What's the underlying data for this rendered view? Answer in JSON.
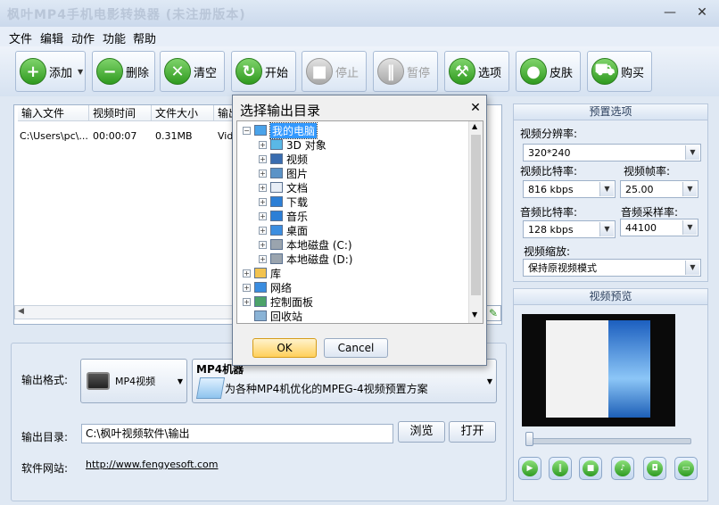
{
  "window": {
    "title": "枫叶MP4手机电影转换器  (未注册版本)",
    "minimize": "—",
    "close": "✕"
  },
  "menu": [
    "文件",
    "编辑",
    "动作",
    "功能",
    "帮助"
  ],
  "toolbar": {
    "add": "添加",
    "delete": "删除",
    "clear": "清空",
    "start": "开始",
    "stop": "停止",
    "pause": "暂停",
    "options": "选项",
    "skin": "皮肤",
    "buy": "购买"
  },
  "file_list": {
    "columns": [
      "输入文件",
      "视频时间",
      "文件大小",
      "输出"
    ],
    "rows": [
      [
        "C:\\Users\\pc\\...",
        "00:00:07",
        "0.31MB",
        "Vid"
      ]
    ]
  },
  "output": {
    "format_label": "输出格式:",
    "format_value": "MP4视频",
    "preset_title": "MP4机器",
    "preset_desc": "为各种MP4机优化的MPEG-4视频预置方案",
    "dir_label": "输出目录:",
    "dir_value": "C:\\枫叶视频软件\\输出",
    "browse": "浏览",
    "open": "打开",
    "site_label": "软件网站:",
    "site_url": "http://www.fengyesoft.com"
  },
  "preset_options": {
    "header": "预置选项",
    "resolution_label": "视频分辨率:",
    "resolution_value": "320*240",
    "vbitrate_label": "视频比特率:",
    "vbitrate_value": "816 kbps",
    "framerate_label": "视频帧率:",
    "framerate_value": "25.00",
    "abitrate_label": "音频比特率:",
    "abitrate_value": "128 kbps",
    "samplerate_label": "音频采样率:",
    "samplerate_value": "44100",
    "scale_label": "视频缩放:",
    "scale_value": "保持原视频模式"
  },
  "preview": {
    "header": "视频预览"
  },
  "dialog": {
    "title": "选择输出目录",
    "close": "✕",
    "tree": [
      {
        "label": "我的电脑",
        "level": 0,
        "expander": "−",
        "icon": "computer-icon"
      },
      {
        "label": "3D 对象",
        "level": 1,
        "expander": "+",
        "icon": "3d-objects-icon"
      },
      {
        "label": "视频",
        "level": 1,
        "expander": "+",
        "icon": "videos-icon"
      },
      {
        "label": "图片",
        "level": 1,
        "expander": "+",
        "icon": "pictures-icon"
      },
      {
        "label": "文档",
        "level": 1,
        "expander": "+",
        "icon": "documents-icon"
      },
      {
        "label": "下载",
        "level": 1,
        "expander": "+",
        "icon": "downloads-icon"
      },
      {
        "label": "音乐",
        "level": 1,
        "expander": "+",
        "icon": "music-icon"
      },
      {
        "label": "桌面",
        "level": 1,
        "expander": "+",
        "icon": "desktop-icon"
      },
      {
        "label": "本地磁盘 (C:)",
        "level": 1,
        "expander": "+",
        "icon": "drive-icon"
      },
      {
        "label": "本地磁盘 (D:)",
        "level": 1,
        "expander": "+",
        "icon": "drive-icon"
      },
      {
        "label": "库",
        "level": 0,
        "expander": "+",
        "icon": "library-icon"
      },
      {
        "label": "网络",
        "level": 0,
        "expander": "+",
        "icon": "network-icon"
      },
      {
        "label": "控制面板",
        "level": 0,
        "expander": "+",
        "icon": "control-panel-icon"
      },
      {
        "label": "回收站",
        "level": 0,
        "expander": "",
        "icon": "recycle-bin-icon"
      }
    ],
    "ok": "OK",
    "cancel": "Cancel"
  },
  "colors": {
    "accent": "#2f9a1f",
    "selection": "#3399ff",
    "panel": "#e6edf6"
  }
}
